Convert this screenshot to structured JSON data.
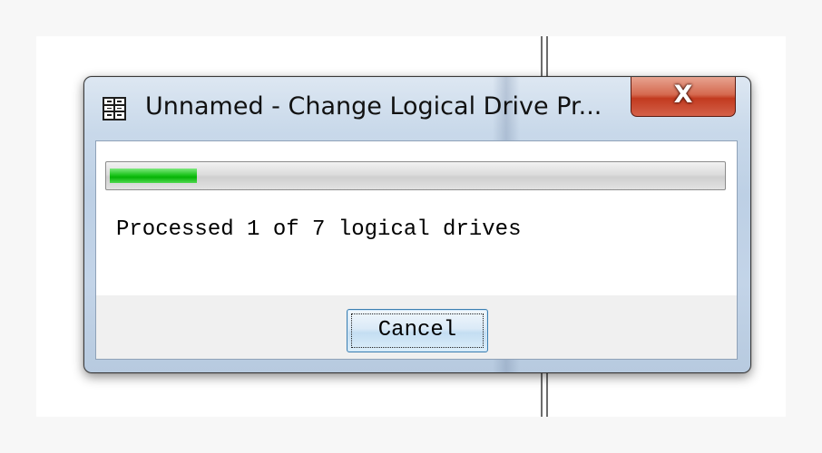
{
  "window": {
    "title": "Unnamed - Change Logical Drive Pr...",
    "close_label": "X"
  },
  "progress": {
    "fraction": 0.1429
  },
  "status_text": "Processed 1 of 7 logical drives",
  "buttons": {
    "cancel_label": "Cancel"
  },
  "colors": {
    "progress_green": "#1ec51e",
    "close_red": "#c23a1f",
    "button_border": "#3c7fb1"
  },
  "icons": {
    "app": "table-grid-icon"
  }
}
